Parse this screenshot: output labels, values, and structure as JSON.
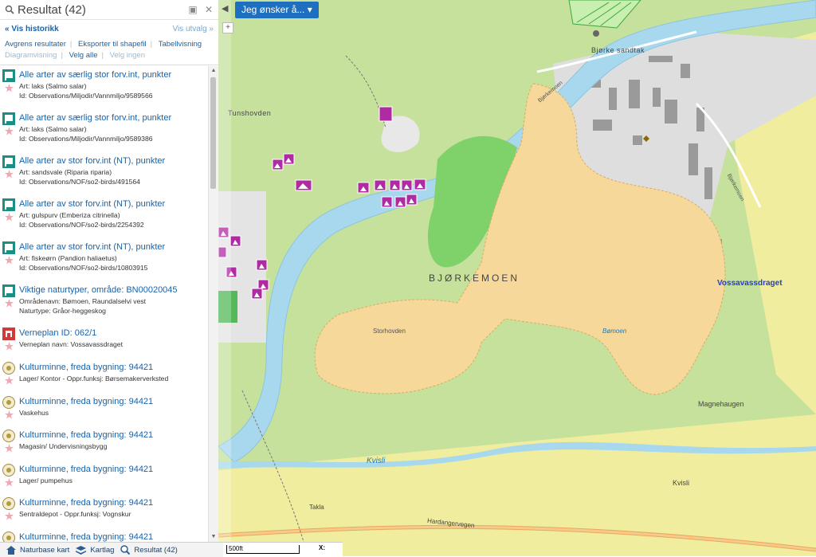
{
  "panel": {
    "title": "Resultat (42)",
    "history_link": "Vis historikk",
    "selection_link": "Vis utvalg",
    "actions": [
      "Avgrens resultater",
      "Eksporter til shapefil",
      "Tabellvisning"
    ],
    "actions2": [
      "Diagramvisning",
      "Velg alle",
      "Velg ingen"
    ]
  },
  "results": [
    {
      "type": "species",
      "title": "Alle arter av særlig stor forv.int, punkter",
      "line1": "Art: laks (Salmo salar)",
      "line2": "Id: Observations/Miljodir/Vannmiljo/9589566"
    },
    {
      "type": "species",
      "title": "Alle arter av særlig stor forv.int, punkter",
      "line1": "Art: laks (Salmo salar)",
      "line2": "Id: Observations/Miljodir/Vannmiljo/9589386"
    },
    {
      "type": "species",
      "title": "Alle arter av stor forv.int (NT), punkter",
      "line1": "Art: sandsvale (Riparia riparia)",
      "line2": "Id: Observations/NOF/so2-birds/491564"
    },
    {
      "type": "species",
      "title": "Alle arter av stor forv.int (NT), punkter",
      "line1": "Art: gulspurv (Emberiza citrinella)",
      "line2": "Id: Observations/NOF/so2-birds/2254392"
    },
    {
      "type": "species",
      "title": "Alle arter av stor forv.int (NT), punkter",
      "line1": "Art: fiskeørn (Pandion haliaetus)",
      "line2": "Id: Observations/NOF/so2-birds/10803915"
    },
    {
      "type": "nature",
      "title": "Viktige naturtyper, område: BN00020045",
      "line1": "Områdenavn: Bømoen, Raundalselvi vest",
      "line2": "Naturtype: Gråor-heggeskog"
    },
    {
      "type": "protect",
      "title": "Verneplan ID: 062/1",
      "line1": "Verneplan navn: Vossavassdraget",
      "line2": ""
    },
    {
      "type": "culture",
      "title": "Kulturminne, freda bygning: 94421",
      "line1": "Lager/ Kontor - Oppr.funksj: Børsemakerverksted",
      "line2": ""
    },
    {
      "type": "culture",
      "title": "Kulturminne, freda bygning: 94421",
      "line1": "Vaskehus",
      "line2": ""
    },
    {
      "type": "culture",
      "title": "Kulturminne, freda bygning: 94421",
      "line1": "Magasin/ Undervisningsbygg",
      "line2": ""
    },
    {
      "type": "culture",
      "title": "Kulturminne, freda bygning: 94421",
      "line1": "Lager/ pumpehus",
      "line2": ""
    },
    {
      "type": "culture",
      "title": "Kulturminne, freda bygning: 94421",
      "line1": "Sentraldepot - Oppr.funksj: Vognskur",
      "line2": ""
    },
    {
      "type": "culture",
      "title": "Kulturminne, freda bygning: 94421",
      "line1": "",
      "line2": ""
    }
  ],
  "tabs": [
    {
      "label": "Naturbase kart",
      "icon": "home-icon"
    },
    {
      "label": "Kartlag",
      "icon": "layers-icon"
    },
    {
      "label": "Resultat (42)",
      "icon": "search-results-icon"
    }
  ],
  "map": {
    "wish_button": "Jeg ønsker å...",
    "labels": {
      "bjorke_sandtak": "Bjørke sandtak",
      "tunshovden": "Tunshovden",
      "bjorkemoen": "BJØRKEMOEN",
      "vossavassdraget": "Vossavassdraget",
      "storhovden": "Storhovden",
      "bamoen": "Bømoen",
      "magnehaugen": "Magnehaugen",
      "kvisli_river": "Kvisli",
      "kvisli": "Kvisli",
      "takla": "Takla",
      "hardangervegen": "Hardangervegen",
      "bjorkemoen_road": "Bjørkemoen",
      "bjorkemoen_road2": "Bjørkemoen"
    },
    "scale": "500ft",
    "xy_label": "X:"
  }
}
